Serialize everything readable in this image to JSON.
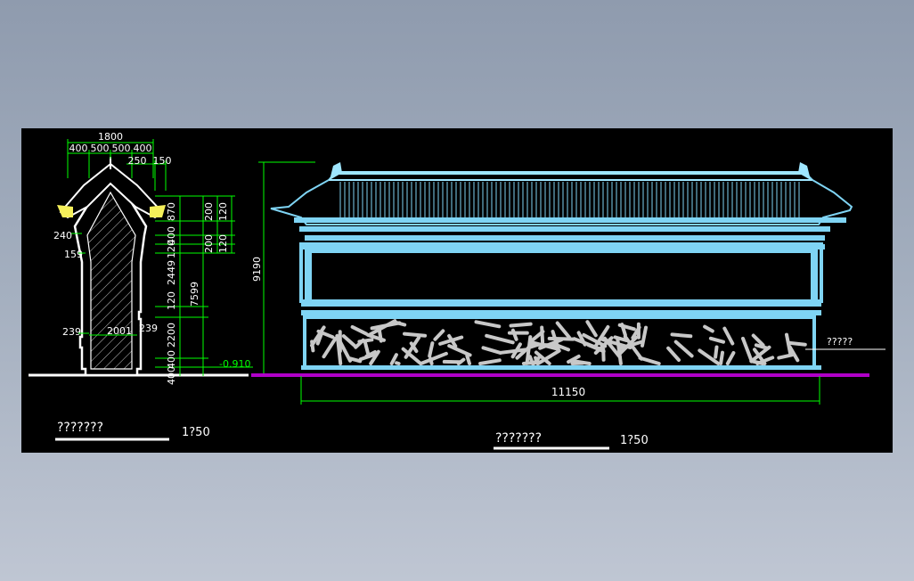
{
  "section": {
    "width_total": "1800",
    "widths": [
      "400",
      "500",
      "500",
      "400"
    ],
    "top_right": [
      "250",
      "150"
    ],
    "height_dims": [
      "870",
      "400",
      "120",
      "2449",
      "120",
      "2200",
      "400",
      "400"
    ],
    "sub_dims": [
      "200",
      "120",
      "200",
      "120"
    ],
    "total_height": "7599",
    "left_labels": [
      "240",
      "159",
      "239"
    ],
    "base_width": "2001",
    "right_label": "239",
    "ground_level": "-0.910",
    "title": "???????",
    "scale": "1?50"
  },
  "elevation": {
    "height": "9190",
    "length": "11150",
    "annotation": "?????",
    "title": "???????",
    "scale": "1?50"
  },
  "colors": {
    "background": "#000000",
    "dimension": "#00ff00",
    "wall": "#7fd4f4",
    "roof_detail": "#9fe6ff",
    "roof_yellow": "#f5f05a",
    "ground": "#b000c8",
    "stone": "#c8c8c8",
    "text": "#ffffff"
  }
}
